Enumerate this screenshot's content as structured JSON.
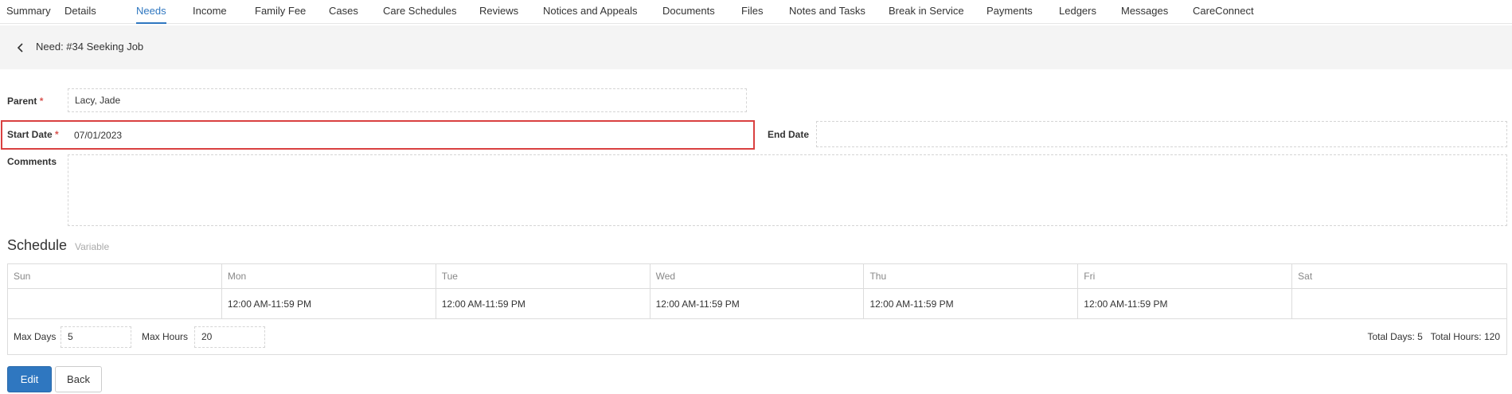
{
  "tabs": [
    {
      "label": "Summary",
      "active": false
    },
    {
      "label": "Details",
      "active": false
    },
    {
      "label": "Needs",
      "active": true
    },
    {
      "label": "Income",
      "active": false
    },
    {
      "label": "Family Fee",
      "active": false
    },
    {
      "label": "Cases",
      "active": false
    },
    {
      "label": "Care Schedules",
      "active": false
    },
    {
      "label": "Reviews",
      "active": false
    },
    {
      "label": "Notices and Appeals",
      "active": false
    },
    {
      "label": "Documents",
      "active": false
    },
    {
      "label": "Files",
      "active": false
    },
    {
      "label": "Notes and Tasks",
      "active": false
    },
    {
      "label": "Break in Service",
      "active": false
    },
    {
      "label": "Payments",
      "active": false
    },
    {
      "label": "Ledgers",
      "active": false
    },
    {
      "label": "Messages",
      "active": false
    },
    {
      "label": "CareConnect",
      "active": false
    }
  ],
  "header": {
    "title": "Need: #34 Seeking Job"
  },
  "form": {
    "parent_label": "Parent",
    "parent_value": "Lacy, Jade",
    "start_date_label": "Start Date",
    "start_date_value": "07/01/2023",
    "end_date_label": "End Date",
    "end_date_value": "",
    "comments_label": "Comments",
    "comments_value": "",
    "required_marker": "*"
  },
  "schedule": {
    "title": "Schedule",
    "mode": "Variable",
    "days": [
      "Sun",
      "Mon",
      "Tue",
      "Wed",
      "Thu",
      "Fri",
      "Sat"
    ],
    "times": [
      "",
      "12:00 AM-11:59 PM",
      "12:00 AM-11:59 PM",
      "12:00 AM-11:59 PM",
      "12:00 AM-11:59 PM",
      "12:00 AM-11:59 PM",
      ""
    ],
    "max_days_label": "Max Days",
    "max_days_value": "5",
    "max_hours_label": "Max Hours",
    "max_hours_value": "20",
    "totals_text": "Total Days: 5   Total Hours: 120"
  },
  "buttons": {
    "edit": "Edit",
    "back": "Back"
  },
  "colors": {
    "accent": "#2f77c0",
    "required": "#d9534f",
    "highlight": "#d94040"
  }
}
